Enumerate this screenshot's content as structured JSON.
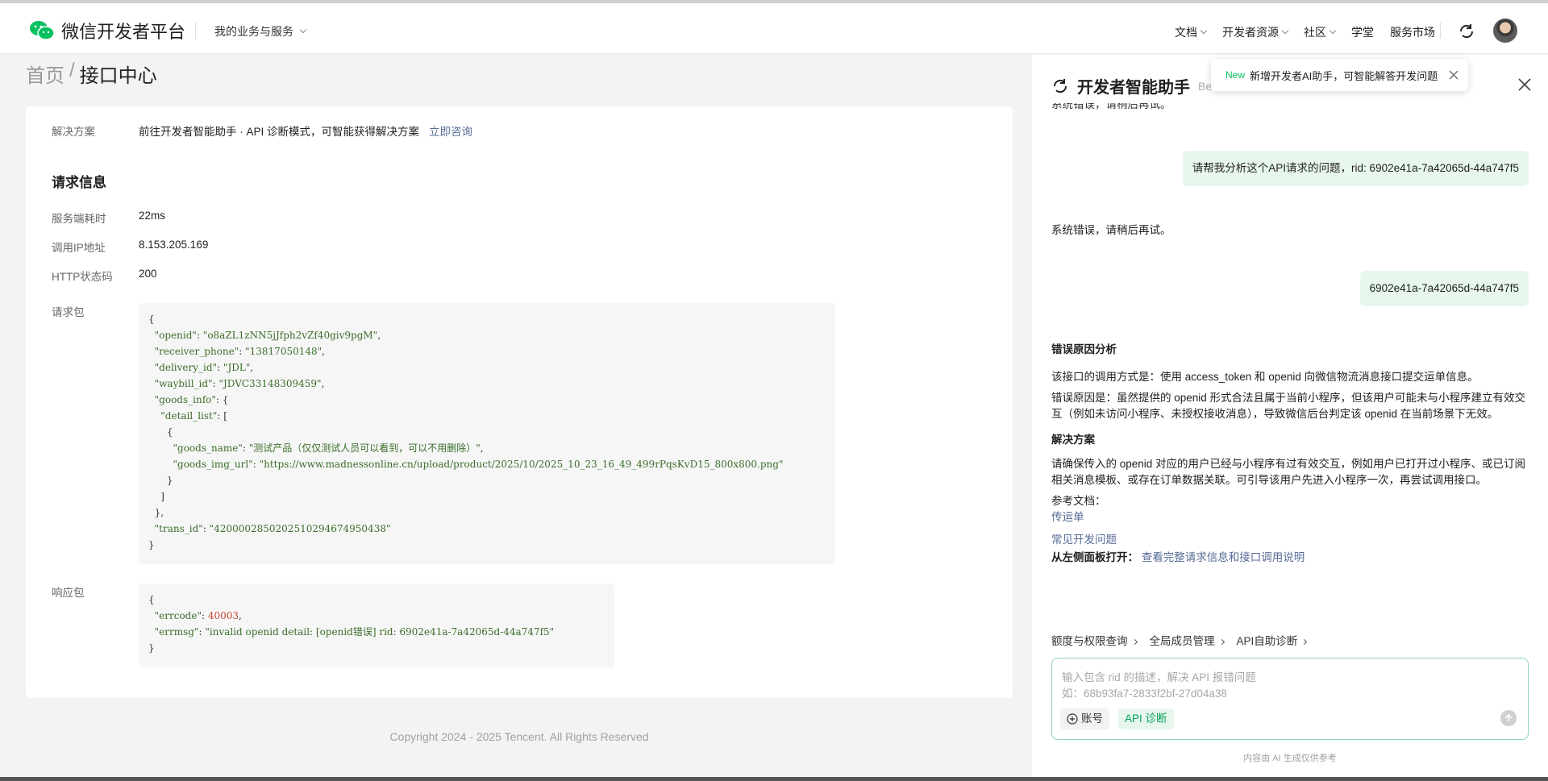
{
  "header": {
    "logo_text": "微信开发者平台",
    "biz_menu": "我的业务与服务",
    "nav": [
      "文档",
      "开发者资源",
      "社区",
      "学堂",
      "服务市场"
    ]
  },
  "breadcrumb": {
    "home": "首页",
    "sep": "/",
    "current": "接口中心"
  },
  "card": {
    "solution_label": "解决方案",
    "solution_value": "前往开发者智能助手 · API 诊断模式，可智能获得解决方案",
    "solution_link": "立即咨询",
    "request_title": "请求信息",
    "rows": [
      {
        "label": "服务端耗时",
        "value": "22ms"
      },
      {
        "label": "调用IP地址",
        "value": "8.153.205.169"
      },
      {
        "label": "HTTP状态码",
        "value": "200"
      }
    ],
    "request_label": "请求包",
    "response_label": "响应包",
    "request_json": {
      "openid_key": "\"openid\"",
      "openid_val": "\"o8aZL1zNN5jJfph2vZf40giv9pgM\"",
      "phone_key": "\"receiver_phone\"",
      "phone_val": "\"13817050148\"",
      "delivery_key": "\"delivery_id\"",
      "delivery_val": "\"JDL\"",
      "waybill_key": "\"waybill_id\"",
      "waybill_val": "\"JDVC33148309459\"",
      "goods_info_key": "\"goods_info\"",
      "detail_list_key": "\"detail_list\"",
      "goods_name_key": "\"goods_name\"",
      "goods_name_val": "\"测试产品（仅仅测试人员可以看到，可以不用删除）\"",
      "goods_img_key": "\"goods_img_url\"",
      "goods_img_val": "\"https://www.madnessonline.cn/upload/product/2025/10/2025_10_23_16_49_499rPqsKvD15_800x800.png\"",
      "trans_key": "\"trans_id\"",
      "trans_val": "\"4200002850202510294674950438\""
    },
    "response_json": {
      "errcode_key": "\"errcode\"",
      "errcode_val": "40003",
      "errmsg_key": "\"errmsg\"",
      "errmsg_val": "\"invalid openid detail: [openid错误] rid: 6902e41a-7a42065d-44a747f5\""
    },
    "copyright": "Copyright 2024 - 2025 Tencent. All Rights Reserved"
  },
  "assistant": {
    "title": "开发者智能助手",
    "beta": "Be",
    "toast_new": "New",
    "toast_text": "新增开发者AI助手，可智能解答开发问题",
    "cut_text": "系统错误，请稍后再试。",
    "user_msg_1": "请帮我分析这个API请求的问题，rid: 6902e41a-7a42065d-44a747f5",
    "ai_msg_1": "系统错误，请稍后再试。",
    "user_msg_2": "6902e41a-7a42065d-44a747f5",
    "cause_title": "错误原因分析",
    "cause_p1": "该接口的调用方式是：使用 access_token 和 openid 向微信物流消息接口提交运单信息。",
    "cause_p2": "错误原因是：虽然提供的 openid 形式合法且属于当前小程序，但该用户可能未与小程序建立有效交互（例如未访问小程序、未授权接收消息），导致微信后台判定该 openid 在当前场景下无效。",
    "solution_title": "解决方案",
    "solution_p": "请确保传入的 openid 对应的用户已经与小程序有过有效交互，例如用户已打开过小程序、或已订阅相关消息模板、或存在订单数据关联。可引导该用户先进入小程序一次，再尝试调用接口。",
    "ref_label": "参考文档：",
    "ref_link_1": "传运单",
    "ref_link_2": "常见开发问题",
    "open_left_label": "从左侧面板打开：",
    "open_left_link": "查看完整请求信息和接口调用说明",
    "quick_1": "额度与权限查询",
    "quick_2": "全局成员管理",
    "quick_3": "API自助诊断",
    "input_placeholder_1": "输入包含 rid 的描述，解决 API 报错问题",
    "input_placeholder_2": "如：68b93fa7-2833f2bf-27d04a38",
    "chip_account": "账号",
    "chip_api": "API 诊断",
    "disclaimer": "内容由 AI 生成仅供参考"
  }
}
